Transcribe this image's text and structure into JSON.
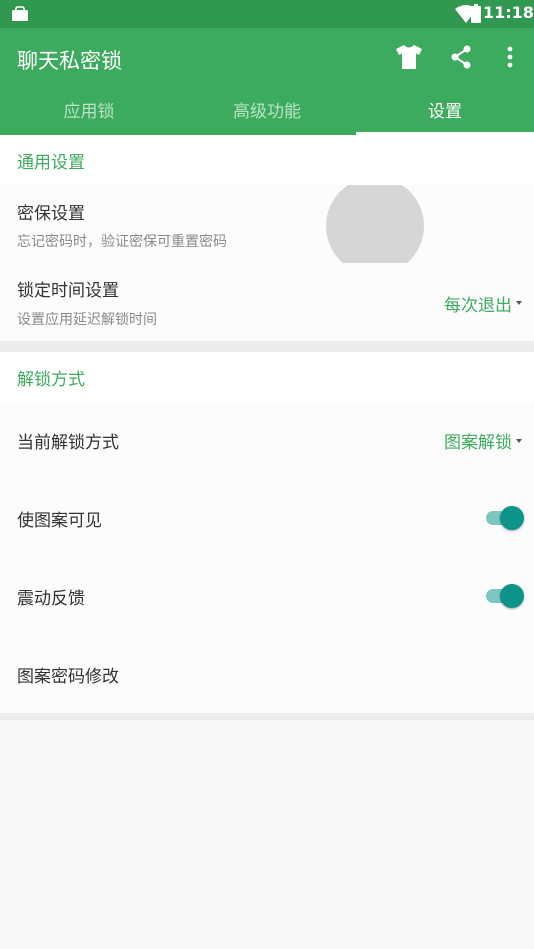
{
  "status_bar": {
    "time": "11:18"
  },
  "app_bar": {
    "title": "聊天私密锁"
  },
  "icons": {
    "shirt": "shirt-icon",
    "share": "share-icon",
    "more": "more-vertical-icon",
    "bag": "shopping-bag-icon",
    "wifi": "wifi-icon",
    "battery": "battery-icon"
  },
  "tabs": [
    {
      "label": "应用锁",
      "active": false
    },
    {
      "label": "高级功能",
      "active": false
    },
    {
      "label": "设置",
      "active": true
    }
  ],
  "sections": [
    {
      "header": "通用设置",
      "rows": [
        {
          "title": "密保设置",
          "subtitle": "忘记密码时，验证密保可重置密码"
        },
        {
          "title": "锁定时间设置",
          "subtitle": "设置应用延迟解锁时间",
          "value": "每次退出"
        }
      ]
    },
    {
      "header": "解锁方式",
      "rows": [
        {
          "title": "当前解锁方式",
          "value": "图案解锁"
        },
        {
          "title": "使图案可见",
          "toggle": true
        },
        {
          "title": "震动反馈",
          "toggle": true
        },
        {
          "title": "图案密码修改"
        }
      ]
    }
  ],
  "colors": {
    "status_bar": "#30984f",
    "primary": "#3dab5e",
    "switch_thumb": "#0d9488",
    "switch_track": "#7ec6c0"
  }
}
